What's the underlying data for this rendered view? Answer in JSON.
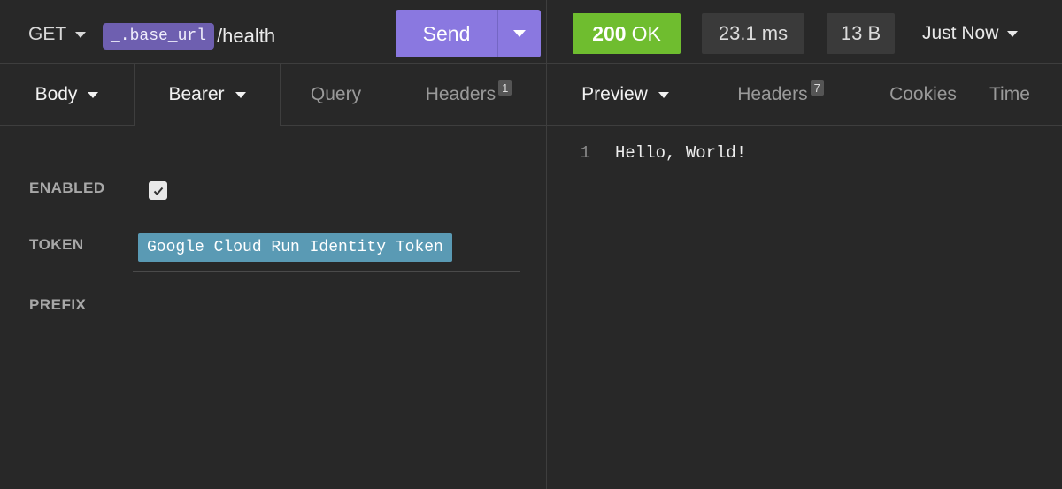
{
  "request": {
    "method": "GET",
    "url_variable": "_.base_url",
    "url_path": "/health",
    "send_label": "Send"
  },
  "request_tabs": [
    {
      "label": "Body",
      "dropdown": true
    },
    {
      "label": "Bearer",
      "dropdown": true
    },
    {
      "label": "Query"
    },
    {
      "label": "Headers",
      "badge": "1"
    }
  ],
  "auth": {
    "enabled_label": "ENABLED",
    "enabled": true,
    "token_label": "TOKEN",
    "token_value": "Google Cloud Run Identity Token",
    "prefix_label": "PREFIX",
    "prefix_value": ""
  },
  "response": {
    "status_code": "200",
    "status_text": "OK",
    "time": "23.1 ms",
    "size": "13 B",
    "history_label": "Just Now",
    "status_color": "#6fbd2f"
  },
  "response_tabs": [
    {
      "label": "Preview",
      "dropdown": true
    },
    {
      "label": "Headers",
      "badge": "7"
    },
    {
      "label": "Cookies"
    },
    {
      "label": "Time"
    }
  ],
  "preview": {
    "lines": [
      {
        "number": "1",
        "text": "Hello, World!"
      }
    ]
  },
  "colors": {
    "background": "#282828",
    "accent": "#8a78e0",
    "variable_chip": "#6e5fb0",
    "token_chip": "#5a9ab4"
  }
}
